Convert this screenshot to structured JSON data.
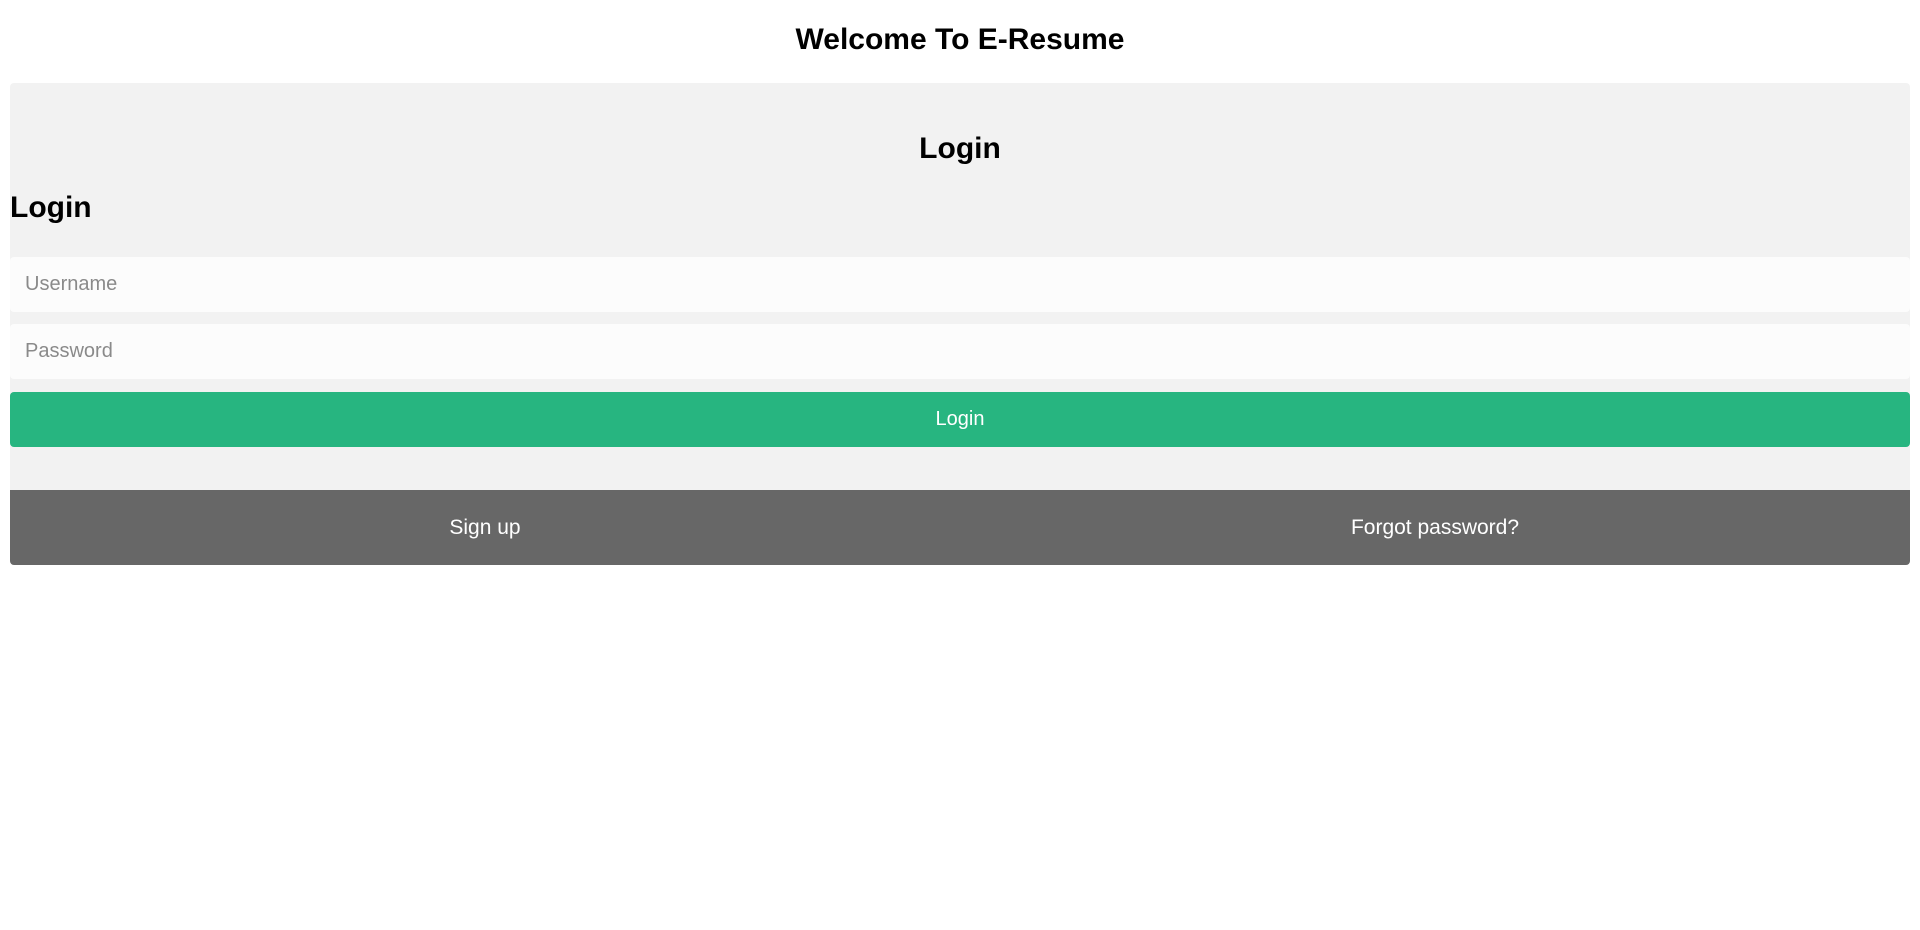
{
  "header": {
    "title": "Welcome To E-Resume"
  },
  "card": {
    "title": "Login",
    "form_title": "Login",
    "username": {
      "value": "",
      "placeholder": "Username"
    },
    "password": {
      "value": "",
      "placeholder": "Password"
    },
    "login_button_label": "Login"
  },
  "footer": {
    "signup_label": "Sign up",
    "forgot_label": "Forgot password?"
  },
  "colors": {
    "accent": "#27b580",
    "card_background": "#f2f2f2",
    "footer_background": "#676767"
  }
}
